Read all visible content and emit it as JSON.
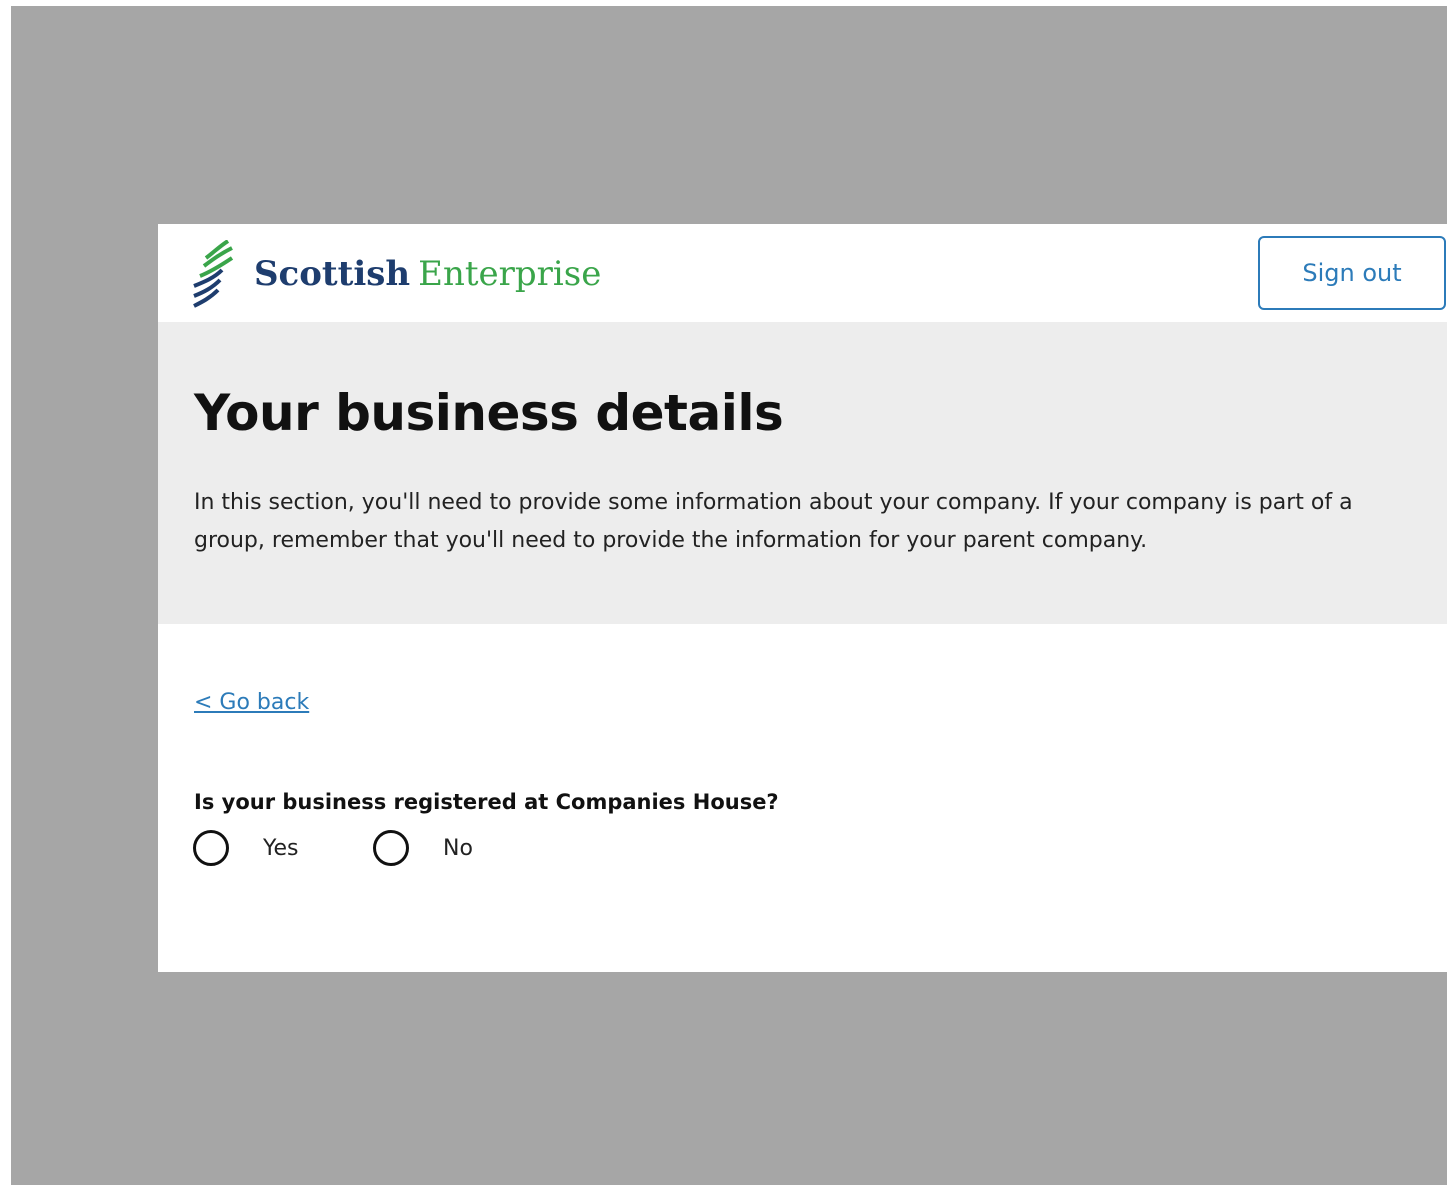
{
  "header": {
    "logo_word1": "Scottish",
    "logo_word2": "Enterprise",
    "sign_out_label": "Sign out"
  },
  "hero": {
    "title": "Your business details",
    "intro": "In this section, you'll need to provide some information about your company. If your company is part of a group, remember that you'll need to provide the information for your parent company."
  },
  "nav": {
    "go_back_label": "< Go back"
  },
  "form": {
    "question": "Is your business registered at Companies House?",
    "options": [
      {
        "label": "Yes",
        "selected": false
      },
      {
        "label": "No",
        "selected": false
      }
    ]
  },
  "colors": {
    "brand_navy": "#1e3d6e",
    "brand_green": "#3aa54a",
    "link_blue": "#2c7bb9",
    "hero_bg": "#ededed",
    "backdrop": "#a6a6a6"
  }
}
